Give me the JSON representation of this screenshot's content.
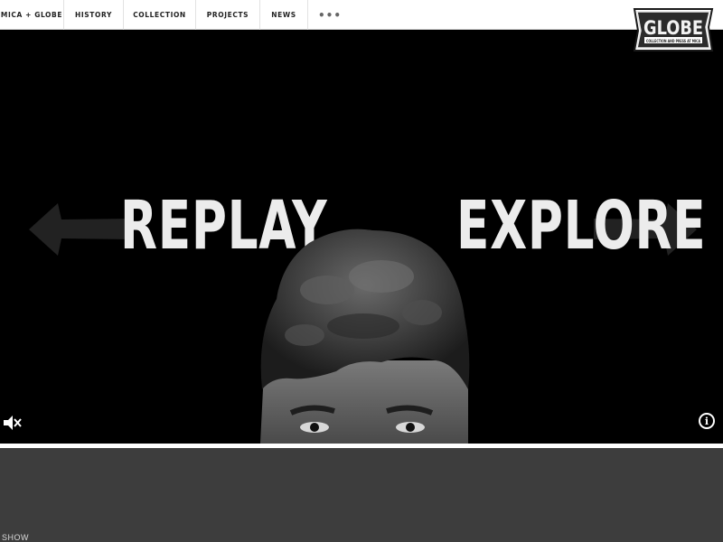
{
  "nav": {
    "items": [
      {
        "label": "MICA + GLOBE"
      },
      {
        "label": "HISTORY"
      },
      {
        "label": "COLLECTION"
      },
      {
        "label": "PROJECTS"
      },
      {
        "label": "NEWS"
      }
    ],
    "more_label": "•••"
  },
  "logo": {
    "title": "GLOBE",
    "subtitle": "COLLECTION AND PRESS AT MICA"
  },
  "hero": {
    "left_word": "REPLAY",
    "right_word": "EXPLORE",
    "info_label": "i"
  },
  "footer": {
    "show_label": "SHOW"
  },
  "colors": {
    "hero_bg": "#000000",
    "nav_bg": "#ffffff",
    "lower_bg": "#3d3d3d",
    "logo_bg": "#2b2b2b"
  },
  "icons": [
    "mute-icon",
    "info-icon",
    "left-arrow-icon",
    "right-arrow-icon",
    "more-icon"
  ]
}
